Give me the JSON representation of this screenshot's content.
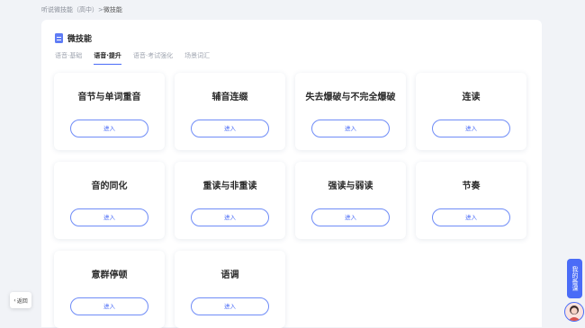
{
  "breadcrumb": {
    "root": "听说微技能（高中）",
    "separator": ">",
    "current": "微技能"
  },
  "panel": {
    "title": "微技能"
  },
  "tabs": [
    {
      "label": "语音·基础"
    },
    {
      "label": "语音·提升"
    },
    {
      "label": "语音·考试强化"
    },
    {
      "label": "场景词汇"
    }
  ],
  "active_tab": "语音·提升",
  "cards": [
    {
      "title": "音节与单词重音",
      "button": "进入"
    },
    {
      "title": "辅音连缀",
      "button": "进入"
    },
    {
      "title": "失去爆破与不完全爆破",
      "button": "进入"
    },
    {
      "title": "连读",
      "button": "进入"
    },
    {
      "title": "音的同化",
      "button": "进入"
    },
    {
      "title": "重读与非重读",
      "button": "进入"
    },
    {
      "title": "强读与弱读",
      "button": "进入"
    },
    {
      "title": "节奏",
      "button": "进入"
    },
    {
      "title": "意群停顿",
      "button": "进入"
    },
    {
      "title": "语调",
      "button": "进入"
    }
  ],
  "back_button": {
    "label": "返回"
  },
  "side_tab": {
    "label": "我的备课"
  },
  "colors": {
    "accent": "#4a6cf7",
    "background": "#f1f3f7"
  }
}
